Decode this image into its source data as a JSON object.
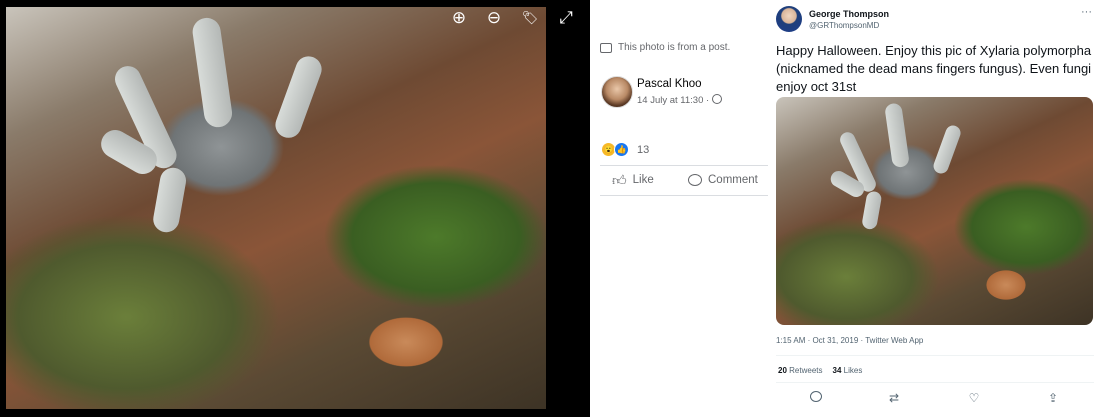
{
  "viewer": {
    "controls": [
      {
        "name": "zoom-in-icon",
        "glyph": "⊕"
      },
      {
        "name": "zoom-out-icon",
        "glyph": "⊖"
      },
      {
        "name": "tag-icon",
        "glyph": "🏷"
      },
      {
        "name": "fullscreen-icon",
        "glyph": "⤢"
      }
    ]
  },
  "fb_post": {
    "from_post": "This photo is from a post.",
    "author": "Pascal Khoo",
    "timestamp": "14 July at 11:30 ·",
    "privacy_icon": "globe-icon",
    "reaction_count": "13",
    "like_label": "Like",
    "comment_label": "Comment"
  },
  "tweet": {
    "name": "George Thompson",
    "handle": "@GRThompsonMD",
    "text": "Happy Halloween.  Enjoy this pic of Xylaria polymorpha (nicknamed the dead mans fingers fungus).  Even fungi enjoy oct 31st",
    "meta": "1:15 AM · Oct 31, 2019 · Twitter Web App",
    "retweets": "20",
    "retweets_label": "Retweets",
    "likes": "34",
    "likes_label": "Likes",
    "more": "···"
  },
  "colors": {
    "fb_blue": "#1877f2",
    "fb_grey": "#65676b",
    "twitter_grey": "#536471"
  }
}
